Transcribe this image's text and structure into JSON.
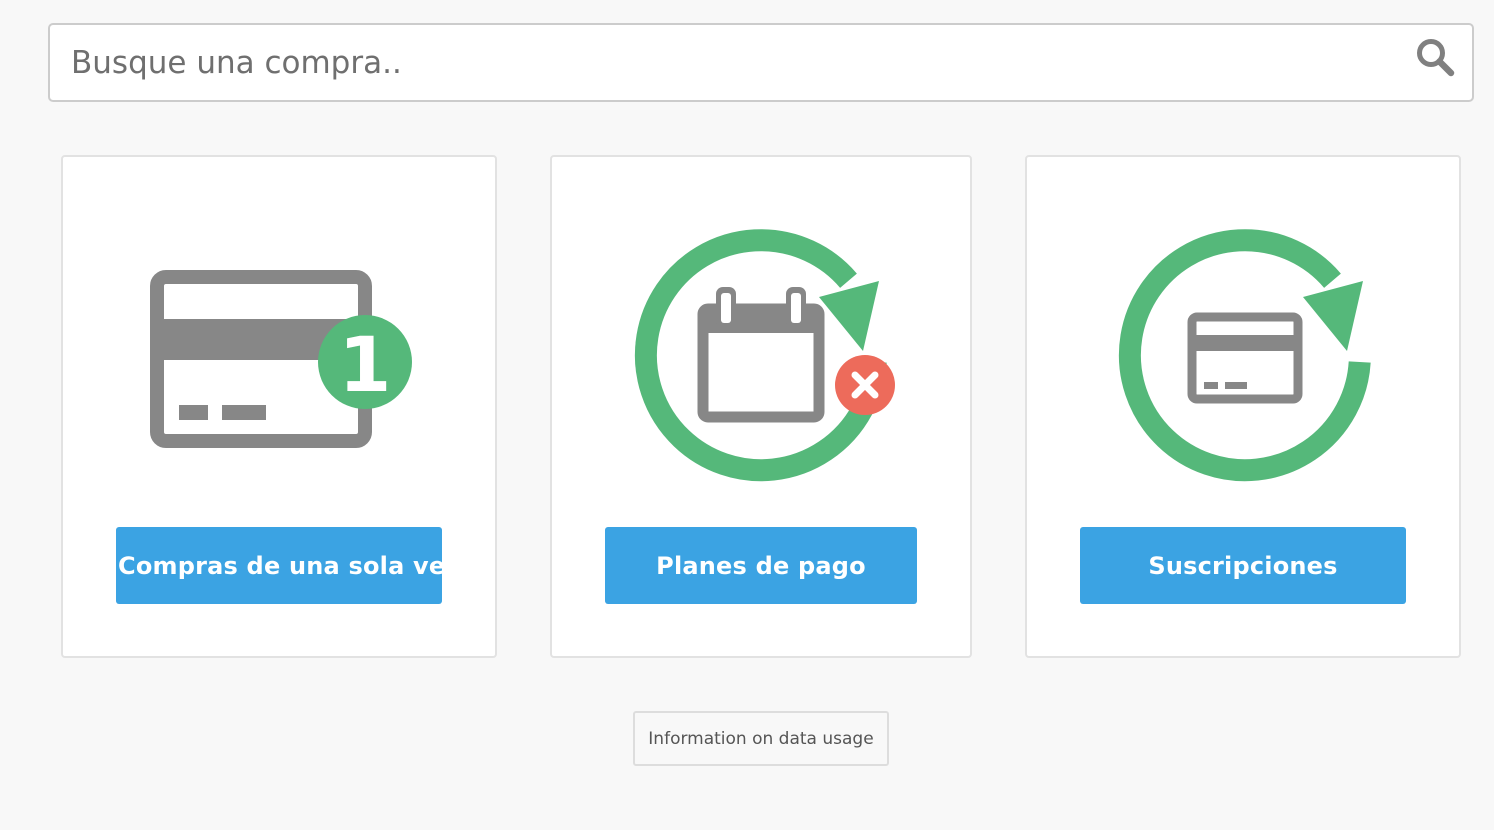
{
  "search": {
    "placeholder": "Busque una compra..",
    "value": "",
    "icon": "search-icon"
  },
  "cards": [
    {
      "icon": "credit-card-one-icon",
      "badge": "1",
      "button_label": "Compras de una sola vez"
    },
    {
      "icon": "payment-plan-icon",
      "button_label": "Planes de pago"
    },
    {
      "icon": "subscription-icon",
      "button_label": "Suscripciones"
    }
  ],
  "footer": {
    "data_usage_label": "Information on data usage"
  },
  "colors": {
    "page_background": "#f8f8f8",
    "card_background": "#ffffff",
    "button_blue": "#3ba3e3",
    "icon_gray": "#878787",
    "icon_green": "#55b87a",
    "icon_red": "#ed6b5b"
  }
}
